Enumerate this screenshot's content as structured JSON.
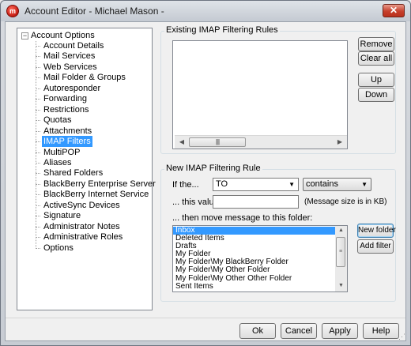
{
  "window": {
    "title": "Account Editor - Michael Mason -",
    "close_glyph": "✕",
    "app_icon_glyph": "m"
  },
  "tree": {
    "root_label": "Account Options",
    "root_toggle": "−",
    "items": [
      {
        "label": "Account Details"
      },
      {
        "label": "Mail Services"
      },
      {
        "label": "Web Services"
      },
      {
        "label": "Mail Folder & Groups"
      },
      {
        "label": "Autoresponder"
      },
      {
        "label": "Forwarding"
      },
      {
        "label": "Restrictions"
      },
      {
        "label": "Quotas"
      },
      {
        "label": "Attachments"
      },
      {
        "label": "IMAP Filters",
        "selected": true
      },
      {
        "label": "MultiPOP"
      },
      {
        "label": "Aliases"
      },
      {
        "label": "Shared Folders"
      },
      {
        "label": "BlackBerry Enterprise Server"
      },
      {
        "label": "BlackBerry Internet Service"
      },
      {
        "label": "ActiveSync Devices"
      },
      {
        "label": "Signature"
      },
      {
        "label": "Administrator Notes"
      },
      {
        "label": "Administrative Roles"
      },
      {
        "label": "Options"
      }
    ]
  },
  "existing_rules": {
    "group_label": "Existing IMAP Filtering Rules",
    "rules": [],
    "remove_label": "Remove",
    "clear_all_label": "Clear all",
    "up_label": "Up",
    "down_label": "Down",
    "scroll_left_glyph": "◀",
    "scroll_right_glyph": "▶",
    "thumb_grip": "||||"
  },
  "new_rule": {
    "group_label": "New IMAP Filtering Rule",
    "if_label": "If the...",
    "field_value": "TO",
    "operator_value": "contains",
    "this_value_label": "... this value:",
    "value_input": "",
    "size_note": "(Message size is in KB)",
    "move_label": "... then move message to this folder:",
    "folders": [
      {
        "label": "Inbox",
        "selected": true
      },
      {
        "label": "Deleted Items"
      },
      {
        "label": "Drafts"
      },
      {
        "label": "My Folder"
      },
      {
        "label": "My Folder\\My BlackBerry Folder"
      },
      {
        "label": "My Folder\\My Other Folder"
      },
      {
        "label": "My Folder\\My Other Other Folder"
      },
      {
        "label": "Sent Items"
      }
    ],
    "new_folder_label": "New folder",
    "add_filter_label": "Add filter",
    "scroll_up_glyph": "▲",
    "scroll_down_glyph": "▼",
    "dropdown_glyph": "▼"
  },
  "footer": {
    "ok_label": "Ok",
    "cancel_label": "Cancel",
    "apply_label": "Apply",
    "help_label": "Help",
    "grip_glyph": "⋰"
  }
}
